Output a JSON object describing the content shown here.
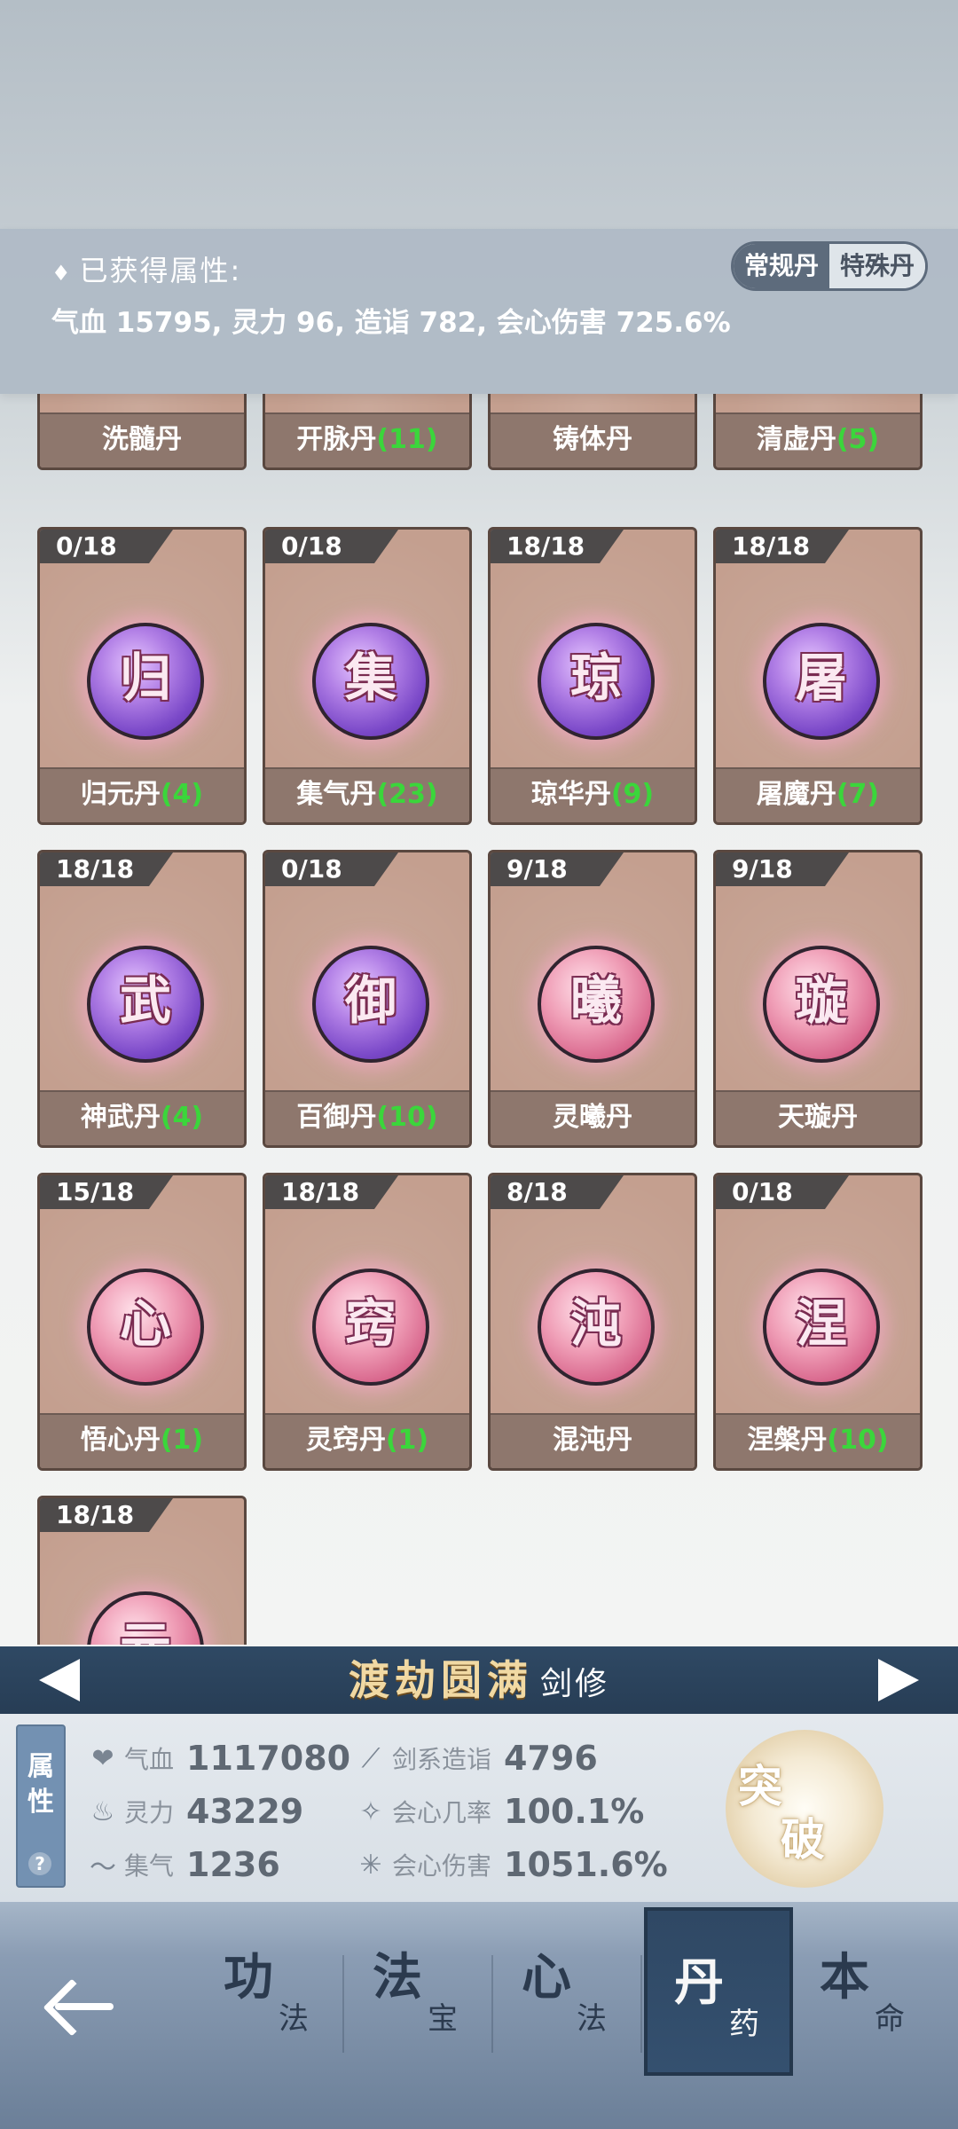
{
  "attributes_obtained": {
    "title": "已获得属性:",
    "value": "气血 15795, 灵力 96, 造诣 782, 会心伤害 725.6%",
    "toggle": {
      "regular": "常规丹",
      "special": "特殊丹"
    }
  },
  "pills": [
    {
      "count": "",
      "name": "洗髓丹",
      "qty": "",
      "char": "",
      "color": "pink"
    },
    {
      "count": "",
      "name": "开脉丹",
      "qty": "(11)",
      "char": "",
      "color": "pink"
    },
    {
      "count": "",
      "name": "铸体丹",
      "qty": "",
      "char": "",
      "color": "pink"
    },
    {
      "count": "",
      "name": "清虚丹",
      "qty": "(5)",
      "char": "",
      "color": "pink"
    },
    {
      "count": "0/18",
      "name": "归元丹",
      "qty": "(4)",
      "char": "归",
      "color": "purple"
    },
    {
      "count": "0/18",
      "name": "集气丹",
      "qty": "(23)",
      "char": "集",
      "color": "purple"
    },
    {
      "count": "18/18",
      "name": "琼华丹",
      "qty": "(9)",
      "char": "琼",
      "color": "purple"
    },
    {
      "count": "18/18",
      "name": "屠魔丹",
      "qty": "(7)",
      "char": "屠",
      "color": "purple"
    },
    {
      "count": "18/18",
      "name": "神武丹",
      "qty": "(4)",
      "char": "武",
      "color": "purple"
    },
    {
      "count": "0/18",
      "name": "百御丹",
      "qty": "(10)",
      "char": "御",
      "color": "purple"
    },
    {
      "count": "9/18",
      "name": "灵曦丹",
      "qty": "",
      "char": "曦",
      "color": "pink"
    },
    {
      "count": "9/18",
      "name": "天璇丹",
      "qty": "",
      "char": "璇",
      "color": "pink"
    },
    {
      "count": "15/18",
      "name": "悟心丹",
      "qty": "(1)",
      "char": "心",
      "color": "pink"
    },
    {
      "count": "18/18",
      "name": "灵窍丹",
      "qty": "(1)",
      "char": "窍",
      "color": "pink"
    },
    {
      "count": "8/18",
      "name": "混沌丹",
      "qty": "",
      "char": "沌",
      "color": "pink"
    },
    {
      "count": "0/18",
      "name": "涅槃丹",
      "qty": "(10)",
      "char": "涅",
      "color": "pink"
    },
    {
      "count": "18/18",
      "name": "",
      "qty": "",
      "char": "元",
      "color": "pink"
    }
  ],
  "stage": {
    "title": "渡劫圆满",
    "class": "剑修"
  },
  "stats": {
    "tag": "属性",
    "help": "?",
    "left": [
      {
        "icon": "heart-icon",
        "glyph": "❤",
        "name": "气血",
        "value": "1117080"
      },
      {
        "icon": "flame-icon",
        "glyph": "♨",
        "name": "灵力",
        "value": "43229"
      },
      {
        "icon": "swirl-icon",
        "glyph": "〜",
        "name": "集气",
        "value": "1236"
      }
    ],
    "right": [
      {
        "icon": "sword-icon",
        "glyph": "⟋",
        "name": "剑系造诣",
        "value": "4796"
      },
      {
        "icon": "spiral-icon",
        "glyph": "✧",
        "name": "会心几率",
        "value": "100.1%"
      },
      {
        "icon": "burst-icon",
        "glyph": "✳",
        "name": "会心伤害",
        "value": "1051.6%"
      }
    ],
    "breakthrough": [
      "突",
      "破"
    ]
  },
  "nav": {
    "tabs": [
      {
        "big": "功",
        "small": "法"
      },
      {
        "big": "法",
        "small": "宝"
      },
      {
        "big": "心",
        "small": "法"
      },
      {
        "big": "丹",
        "small": "药",
        "active": true
      },
      {
        "big": "本",
        "small": "命"
      }
    ]
  }
}
